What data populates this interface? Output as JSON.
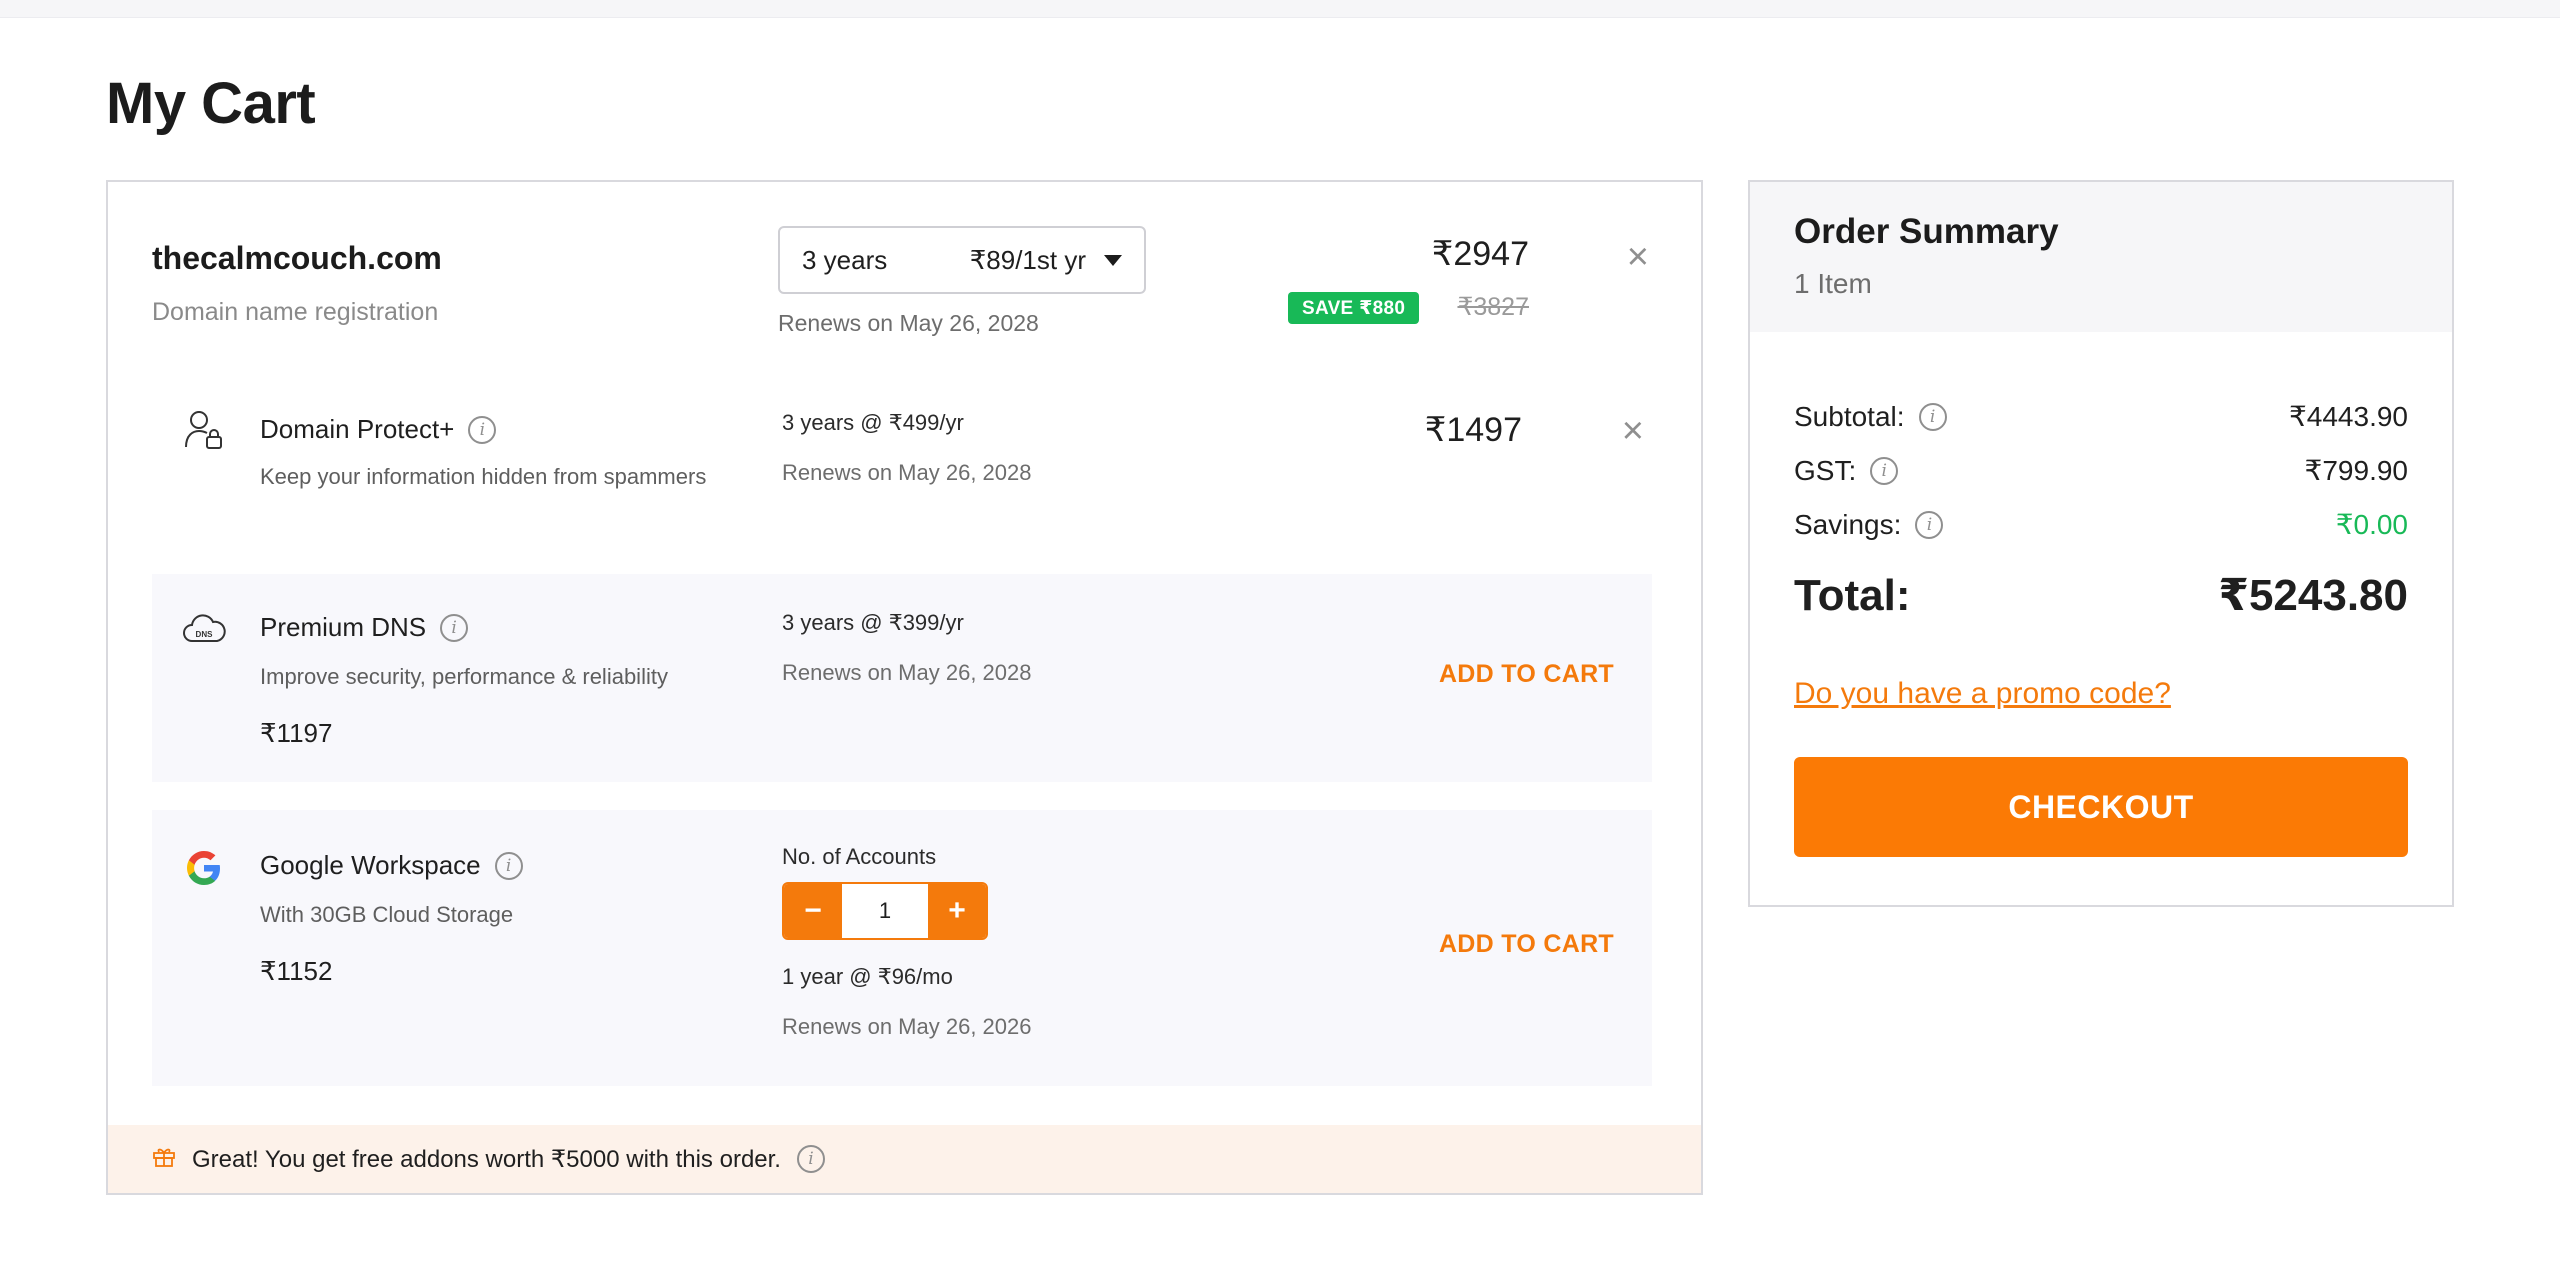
{
  "page": {
    "title": "My Cart"
  },
  "domain": {
    "name": "thecalmcouch.com",
    "subtitle": "Domain name registration",
    "term": "3 years",
    "rate": "₹89/1st yr",
    "renews": "Renews on May 26, 2028",
    "price": "₹2947",
    "save_badge": "SAVE ₹880",
    "original_price": "₹3827"
  },
  "addons": {
    "protect": {
      "title": "Domain Protect+",
      "description": "Keep your information hidden from spammers",
      "term": "3 years @ ₹499/yr",
      "renews": "Renews on May 26, 2028",
      "price": "₹1497"
    },
    "dns": {
      "title": "Premium DNS",
      "description": "Improve security, performance & reliability",
      "price": "₹1197",
      "term": "3 years @ ₹399/yr",
      "renews": "Renews on May 26, 2028",
      "add_label": "ADD TO CART",
      "icon_text": "DNS"
    },
    "workspace": {
      "title": "Google Workspace",
      "description": "With 30GB Cloud Storage",
      "price": "₹1152",
      "accounts_label": "No. of Accounts",
      "accounts_value": "1",
      "minus": "−",
      "plus": "+",
      "term": "1 year @ ₹96/mo",
      "renews": "Renews on May 26, 2026",
      "add_label": "ADD TO CART",
      "icon_letter": "G"
    }
  },
  "banner": {
    "text": "Great! You get free addons worth ₹5000 with this order."
  },
  "summary": {
    "title": "Order Summary",
    "count": "1 Item",
    "subtotal_label": "Subtotal:",
    "subtotal": "₹4443.90",
    "gst_label": "GST:",
    "gst": "₹799.90",
    "savings_label": "Savings:",
    "savings": "₹0.00",
    "total_label": "Total:",
    "total": "₹5243.80",
    "promo": "Do you have a promo code?",
    "checkout": "CHECKOUT"
  },
  "icons": {
    "close": "×",
    "info": "i"
  },
  "colors": {
    "accent": "#f47a0c",
    "checkout": "#fb7a05",
    "save_green": "#18b957",
    "banner_bg": "#fdf2ea",
    "addon_bg": "#f8f8fc"
  }
}
